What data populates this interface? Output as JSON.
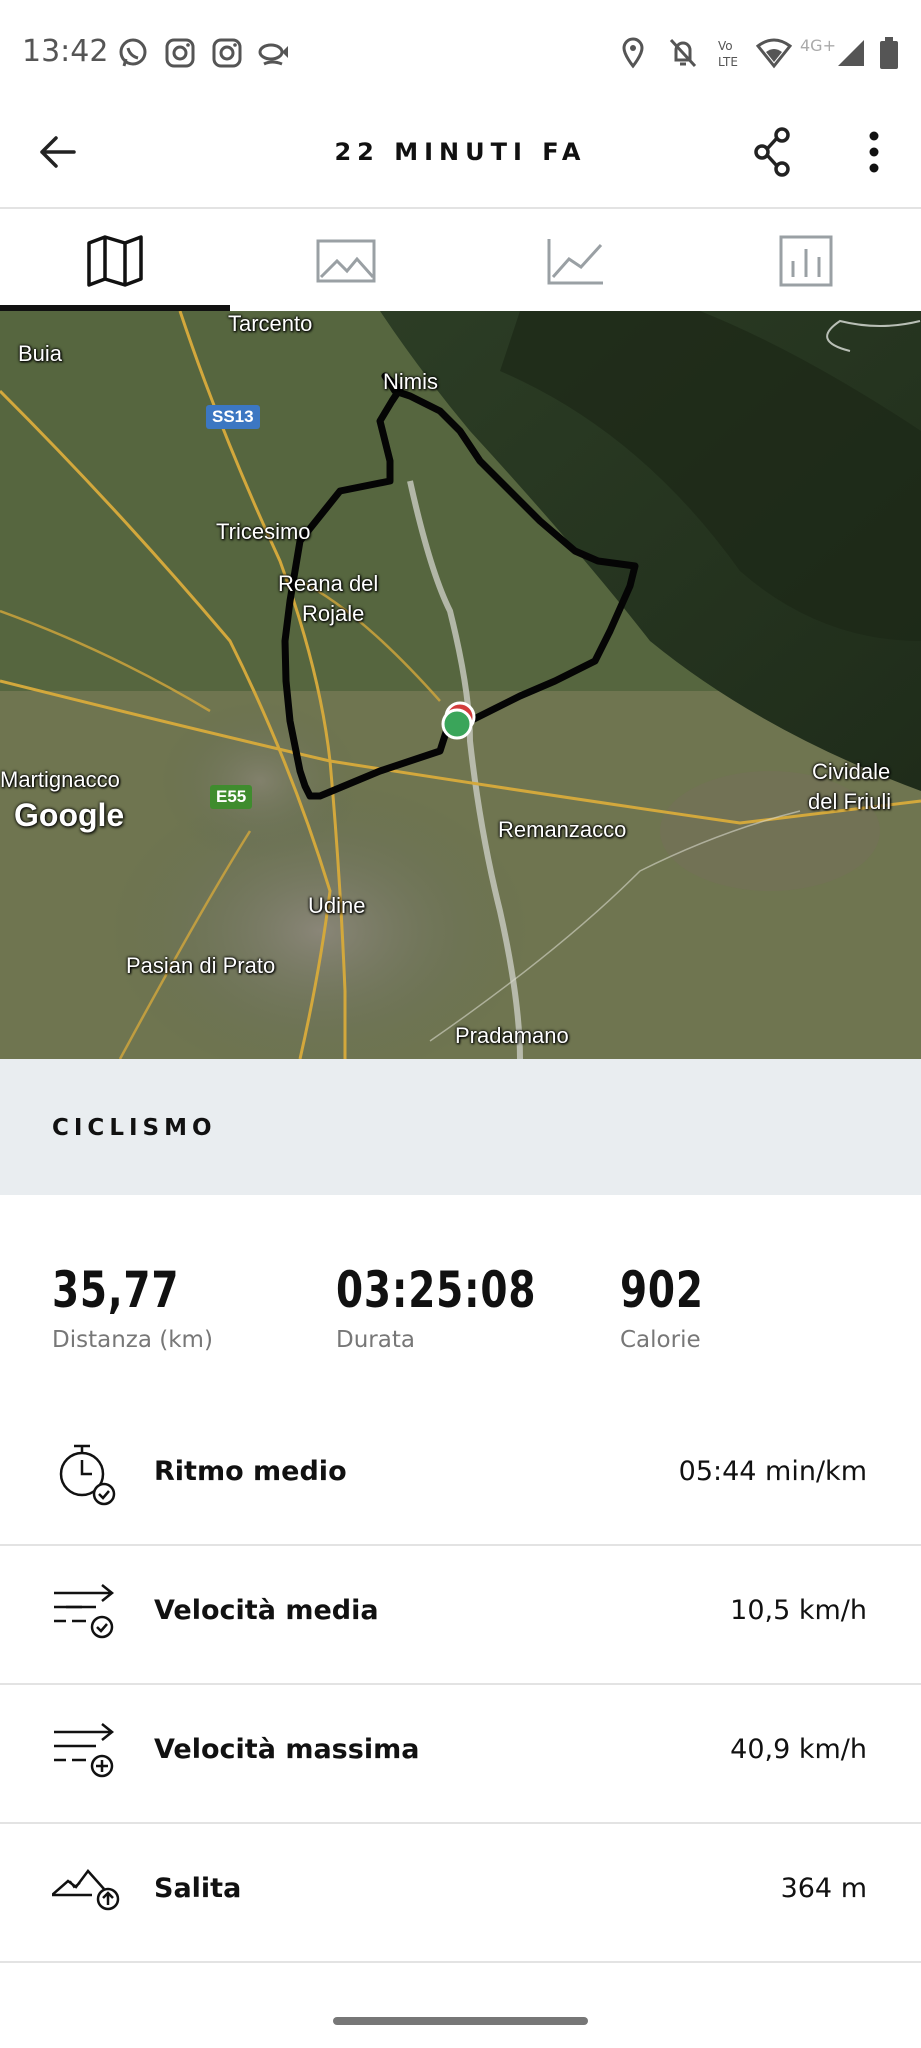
{
  "status_bar": {
    "time": "13:42",
    "network_label": "4G+",
    "app_icons": [
      "whatsapp-icon",
      "instagram-icon",
      "instagram-icon",
      "fish-icon"
    ],
    "system_icons": [
      "location-icon",
      "bell-off-icon",
      "volte-icon",
      "wifi-icon",
      "signal-icon",
      "battery-icon"
    ]
  },
  "header": {
    "title": "22 MINUTI FA"
  },
  "tabs": [
    {
      "name": "map",
      "icon": "map-icon",
      "active": true
    },
    {
      "name": "photos",
      "icon": "image-icon",
      "active": false
    },
    {
      "name": "graph",
      "icon": "line-chart-icon",
      "active": false
    },
    {
      "name": "splits",
      "icon": "bar-chart-icon",
      "active": false
    }
  ],
  "map": {
    "places": {
      "tarcento": "Tarcento",
      "buia": "Buia",
      "nimis": "Nimis",
      "tricesimo": "Tricesimo",
      "reana_line1": "Reana del",
      "reana_line2": "Rojale",
      "martignacco": "Martignacco",
      "cividale_line1": "Cividale",
      "cividale_line2": "del Friuli",
      "remanzacco": "Remanzacco",
      "udine": "Udine",
      "pasian": "Pasian di Prato",
      "pradamano": "Pradamano"
    },
    "road_badges": {
      "ss13": "SS13",
      "e55": "E55"
    },
    "attribution": "Google"
  },
  "activity": {
    "type_label": "CICLISMO"
  },
  "summary": {
    "distance": {
      "value": "35,77",
      "label": "Distanza (km)"
    },
    "duration": {
      "value": "03:25:08",
      "label": "Durata"
    },
    "calories": {
      "value": "902",
      "label": "Calorie"
    }
  },
  "metrics": [
    {
      "label": "Ritmo medio",
      "value": "05:44 min/km",
      "icon": "stopwatch-icon"
    },
    {
      "label": "Velocità media",
      "value": "10,5 km/h",
      "icon": "speed-avg-icon"
    },
    {
      "label": "Velocità massima",
      "value": "40,9 km/h",
      "icon": "speed-max-icon"
    },
    {
      "label": "Salita",
      "value": "364 m",
      "icon": "elevation-icon"
    }
  ],
  "colors": {
    "accent": "#111111",
    "section_bg": "#e9edf0",
    "route": "#000000",
    "start_marker": "#3aa55a",
    "end_marker": "#d23b3b"
  }
}
